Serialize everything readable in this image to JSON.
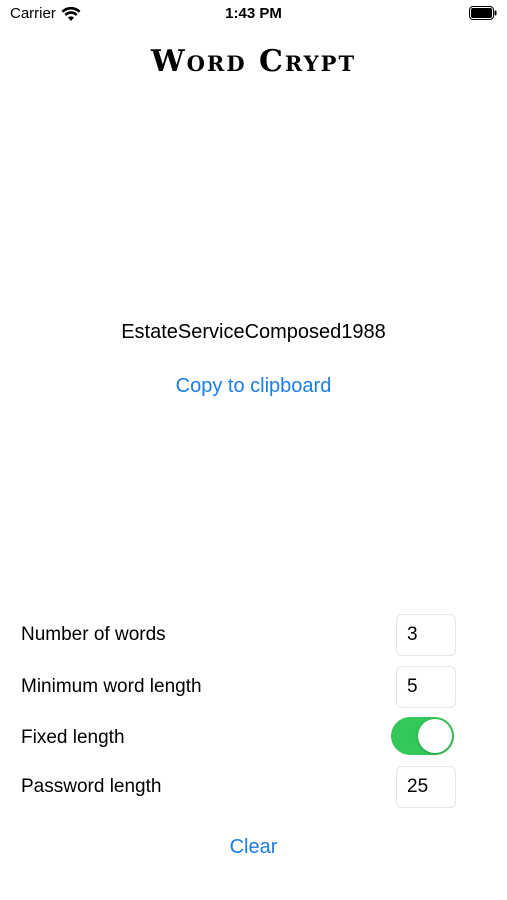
{
  "status_bar": {
    "carrier": "Carrier",
    "time": "1:43 PM",
    "wifi_icon": "wifi-icon",
    "battery_icon": "battery-icon"
  },
  "app": {
    "title": "Word Crypt"
  },
  "result": {
    "password": "EstateServiceComposed1988",
    "copy_label": "Copy to clipboard"
  },
  "settings": {
    "num_words_label": "Number of words",
    "num_words_value": "3",
    "min_length_label": "Minimum word length",
    "min_length_value": "5",
    "fixed_length_label": "Fixed length",
    "fixed_length_on": true,
    "password_length_label": "Password length",
    "password_length_value": "25"
  },
  "actions": {
    "clear_label": "Clear"
  },
  "colors": {
    "link": "#1a7ee6",
    "toggle_on": "#34c759"
  }
}
